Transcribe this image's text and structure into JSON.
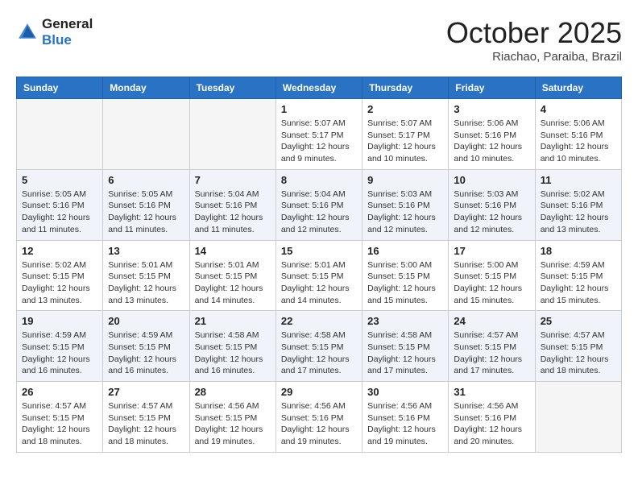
{
  "header": {
    "logo_line1": "General",
    "logo_line2": "Blue",
    "month": "October 2025",
    "location": "Riachao, Paraiba, Brazil"
  },
  "weekdays": [
    "Sunday",
    "Monday",
    "Tuesday",
    "Wednesday",
    "Thursday",
    "Friday",
    "Saturday"
  ],
  "weeks": [
    [
      {
        "day": "",
        "info": ""
      },
      {
        "day": "",
        "info": ""
      },
      {
        "day": "",
        "info": ""
      },
      {
        "day": "1",
        "info": "Sunrise: 5:07 AM\nSunset: 5:17 PM\nDaylight: 12 hours\nand 9 minutes."
      },
      {
        "day": "2",
        "info": "Sunrise: 5:07 AM\nSunset: 5:17 PM\nDaylight: 12 hours\nand 10 minutes."
      },
      {
        "day": "3",
        "info": "Sunrise: 5:06 AM\nSunset: 5:16 PM\nDaylight: 12 hours\nand 10 minutes."
      },
      {
        "day": "4",
        "info": "Sunrise: 5:06 AM\nSunset: 5:16 PM\nDaylight: 12 hours\nand 10 minutes."
      }
    ],
    [
      {
        "day": "5",
        "info": "Sunrise: 5:05 AM\nSunset: 5:16 PM\nDaylight: 12 hours\nand 11 minutes."
      },
      {
        "day": "6",
        "info": "Sunrise: 5:05 AM\nSunset: 5:16 PM\nDaylight: 12 hours\nand 11 minutes."
      },
      {
        "day": "7",
        "info": "Sunrise: 5:04 AM\nSunset: 5:16 PM\nDaylight: 12 hours\nand 11 minutes."
      },
      {
        "day": "8",
        "info": "Sunrise: 5:04 AM\nSunset: 5:16 PM\nDaylight: 12 hours\nand 12 minutes."
      },
      {
        "day": "9",
        "info": "Sunrise: 5:03 AM\nSunset: 5:16 PM\nDaylight: 12 hours\nand 12 minutes."
      },
      {
        "day": "10",
        "info": "Sunrise: 5:03 AM\nSunset: 5:16 PM\nDaylight: 12 hours\nand 12 minutes."
      },
      {
        "day": "11",
        "info": "Sunrise: 5:02 AM\nSunset: 5:16 PM\nDaylight: 12 hours\nand 13 minutes."
      }
    ],
    [
      {
        "day": "12",
        "info": "Sunrise: 5:02 AM\nSunset: 5:15 PM\nDaylight: 12 hours\nand 13 minutes."
      },
      {
        "day": "13",
        "info": "Sunrise: 5:01 AM\nSunset: 5:15 PM\nDaylight: 12 hours\nand 13 minutes."
      },
      {
        "day": "14",
        "info": "Sunrise: 5:01 AM\nSunset: 5:15 PM\nDaylight: 12 hours\nand 14 minutes."
      },
      {
        "day": "15",
        "info": "Sunrise: 5:01 AM\nSunset: 5:15 PM\nDaylight: 12 hours\nand 14 minutes."
      },
      {
        "day": "16",
        "info": "Sunrise: 5:00 AM\nSunset: 5:15 PM\nDaylight: 12 hours\nand 15 minutes."
      },
      {
        "day": "17",
        "info": "Sunrise: 5:00 AM\nSunset: 5:15 PM\nDaylight: 12 hours\nand 15 minutes."
      },
      {
        "day": "18",
        "info": "Sunrise: 4:59 AM\nSunset: 5:15 PM\nDaylight: 12 hours\nand 15 minutes."
      }
    ],
    [
      {
        "day": "19",
        "info": "Sunrise: 4:59 AM\nSunset: 5:15 PM\nDaylight: 12 hours\nand 16 minutes."
      },
      {
        "day": "20",
        "info": "Sunrise: 4:59 AM\nSunset: 5:15 PM\nDaylight: 12 hours\nand 16 minutes."
      },
      {
        "day": "21",
        "info": "Sunrise: 4:58 AM\nSunset: 5:15 PM\nDaylight: 12 hours\nand 16 minutes."
      },
      {
        "day": "22",
        "info": "Sunrise: 4:58 AM\nSunset: 5:15 PM\nDaylight: 12 hours\nand 17 minutes."
      },
      {
        "day": "23",
        "info": "Sunrise: 4:58 AM\nSunset: 5:15 PM\nDaylight: 12 hours\nand 17 minutes."
      },
      {
        "day": "24",
        "info": "Sunrise: 4:57 AM\nSunset: 5:15 PM\nDaylight: 12 hours\nand 17 minutes."
      },
      {
        "day": "25",
        "info": "Sunrise: 4:57 AM\nSunset: 5:15 PM\nDaylight: 12 hours\nand 18 minutes."
      }
    ],
    [
      {
        "day": "26",
        "info": "Sunrise: 4:57 AM\nSunset: 5:15 PM\nDaylight: 12 hours\nand 18 minutes."
      },
      {
        "day": "27",
        "info": "Sunrise: 4:57 AM\nSunset: 5:15 PM\nDaylight: 12 hours\nand 18 minutes."
      },
      {
        "day": "28",
        "info": "Sunrise: 4:56 AM\nSunset: 5:15 PM\nDaylight: 12 hours\nand 19 minutes."
      },
      {
        "day": "29",
        "info": "Sunrise: 4:56 AM\nSunset: 5:16 PM\nDaylight: 12 hours\nand 19 minutes."
      },
      {
        "day": "30",
        "info": "Sunrise: 4:56 AM\nSunset: 5:16 PM\nDaylight: 12 hours\nand 19 minutes."
      },
      {
        "day": "31",
        "info": "Sunrise: 4:56 AM\nSunset: 5:16 PM\nDaylight: 12 hours\nand 20 minutes."
      },
      {
        "day": "",
        "info": ""
      }
    ]
  ]
}
